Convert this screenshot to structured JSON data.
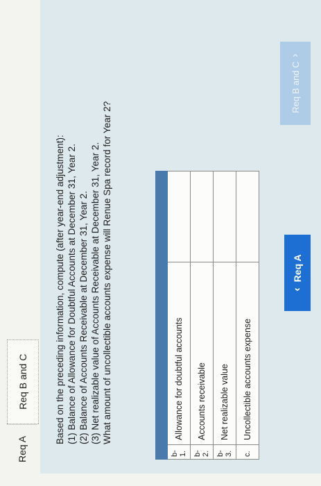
{
  "tabs": {
    "tab_a": "Req A",
    "tab_bc": "Req B and C"
  },
  "question": {
    "line1": "Based on the preceding information, compute (after year-end adjustment):",
    "line2": "(1) Balance of Allowance for Doubtful Accounts at December 31, Year 2.",
    "line3": "(2) Balance of Accounts Receivable at December 31, Year 2.",
    "line4": "(3) Net realizable value of Accounts Receivable at December 31, Year 2.",
    "line5": "What amount of uncollectible accounts expense will Renue Spa record for Year 2?"
  },
  "answer_table": {
    "rows": [
      {
        "code": "b-1.",
        "label": "Allowance for doubtful accounts",
        "value": ""
      },
      {
        "code": "b-2.",
        "label": "Accounts receivable",
        "value": ""
      },
      {
        "code": "b-3.",
        "label": "Net realizable value",
        "value": ""
      },
      {
        "code": "c.",
        "label": "Uncollectible accounts expense",
        "value": ""
      }
    ]
  },
  "nav": {
    "prev_label": "Req A",
    "next_label": "Req B and C"
  },
  "colors": {
    "panel_bg": "#dde9ec",
    "table_header": "#4a79ae",
    "prev_button": "#1e6fd3",
    "next_button_disabled": "#aecbe8"
  }
}
